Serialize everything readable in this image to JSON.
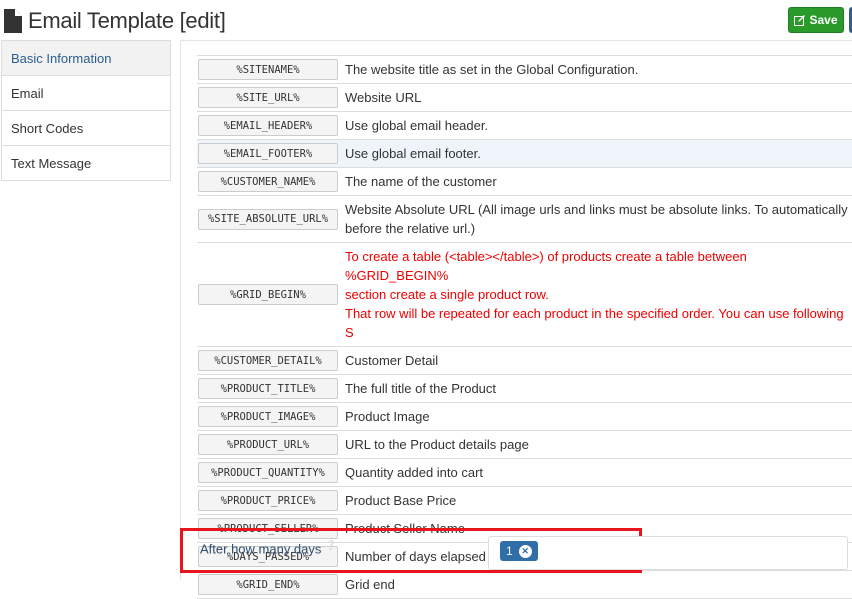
{
  "header": {
    "title": "Email Template [edit]",
    "save_label": "Save"
  },
  "sidebar": {
    "items": [
      {
        "label": "Basic Information",
        "active": true
      },
      {
        "label": "Email"
      },
      {
        "label": "Short Codes"
      },
      {
        "label": "Text Message"
      }
    ]
  },
  "shortcodes": [
    {
      "code": "%SITENAME%",
      "desc": [
        "The website title as set in the Global Configuration."
      ]
    },
    {
      "code": "%SITE_URL%",
      "desc": [
        "Website URL"
      ]
    },
    {
      "code": "%EMAIL_HEADER%",
      "desc": [
        "Use global email header."
      ]
    },
    {
      "code": "%EMAIL_FOOTER%",
      "desc": [
        "Use global email footer."
      ],
      "highlight": true
    },
    {
      "code": "%CUSTOMER_NAME%",
      "desc": [
        "The name of the customer"
      ]
    },
    {
      "code": "%SITE_ABSOLUTE_URL%",
      "desc": [
        "Website Absolute URL (All image urls and links must be absolute links. To automatically",
        "before the relative url.)"
      ]
    },
    {
      "code": "%GRID_BEGIN%",
      "desc": [
        "To create a table (<table></table>) of products create a table between %GRID_BEGIN%",
        "section create a single product row.",
        "That row will be repeated for each product in the specified order. You can use following S"
      ],
      "warning": true
    },
    {
      "code": "%CUSTOMER_DETAIL%",
      "desc": [
        "Customer Detail"
      ]
    },
    {
      "code": "%PRODUCT_TITLE%",
      "desc": [
        "The full title of the Product"
      ]
    },
    {
      "code": "%PRODUCT_IMAGE%",
      "desc": [
        "Product Image"
      ]
    },
    {
      "code": "%PRODUCT_URL%",
      "desc": [
        "URL to the Product details page"
      ]
    },
    {
      "code": "%PRODUCT_QUANTITY%",
      "desc": [
        "Quantity added into cart"
      ]
    },
    {
      "code": "%PRODUCT_PRICE%",
      "desc": [
        "Product Base Price"
      ]
    },
    {
      "code": "%PRODUCT_SELLER%",
      "desc": [
        "Product Seller Name"
      ]
    },
    {
      "code": "%DAYS_PASSED%",
      "desc": [
        "Number of days elapsed since product added to cart"
      ]
    },
    {
      "code": "%GRID_END%",
      "desc": [
        "Grid end"
      ]
    }
  ],
  "days_field": {
    "label": "After how many days",
    "help_icon": "question-circle-icon",
    "tags": [
      "1"
    ]
  },
  "colors": {
    "save": "#2a9b2a",
    "tag": "#2f6ea6",
    "highlight_border": "#e8161c",
    "warning_text": "#ee0000"
  }
}
